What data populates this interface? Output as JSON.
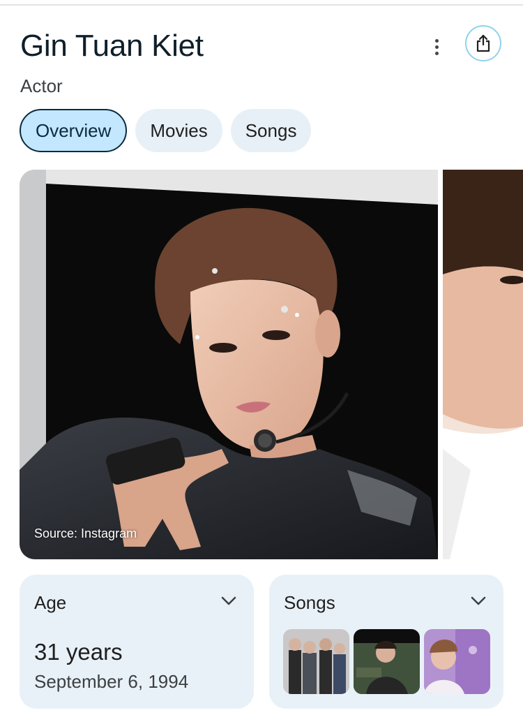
{
  "header": {
    "name": "Gin Tuan Kiet",
    "profession": "Actor",
    "more_icon": "more-vert-icon",
    "share_icon": "share-icon"
  },
  "tabs": [
    {
      "label": "Overview",
      "active": true
    },
    {
      "label": "Movies",
      "active": false
    },
    {
      "label": "Songs",
      "active": false
    }
  ],
  "gallery": {
    "source_caption": "Source: Instagram"
  },
  "cards": {
    "age": {
      "label": "Age",
      "value": "31 years",
      "date": "September 6, 1994",
      "icon": "chevron-down-icon"
    },
    "songs": {
      "label": "Songs",
      "icon": "chevron-down-icon",
      "thumbnail_count": 3
    }
  },
  "colors": {
    "accent": "#c2e7ff",
    "chip_bg": "#e8f0f7",
    "card_bg": "#e9f1f8",
    "share_ring": "#8fd3ee"
  }
}
